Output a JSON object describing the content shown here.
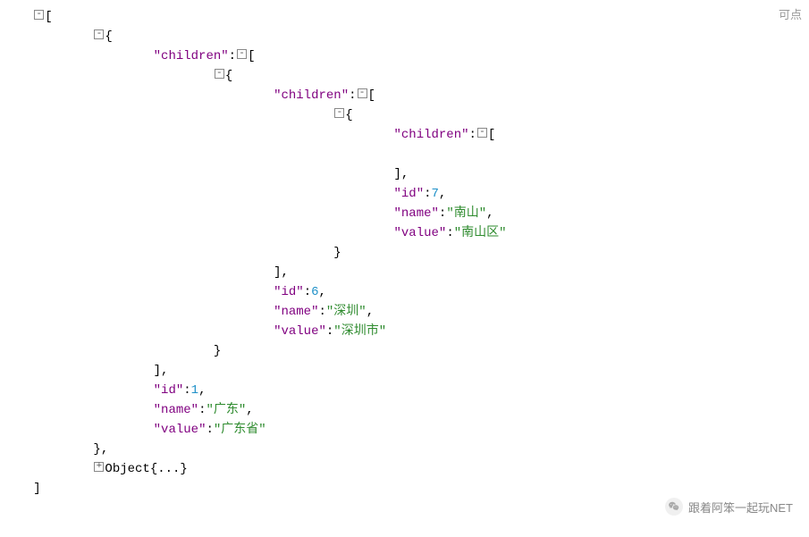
{
  "topRight": "可点",
  "watermark": "跟着阿笨一起玩NET",
  "keys": {
    "children": "children",
    "id": "id",
    "name": "name",
    "value": "value"
  },
  "collapsed": "Object{...}",
  "tree": {
    "level1": {
      "id": 1,
      "name": "广东",
      "value": "广东省"
    },
    "level2": {
      "id": 6,
      "name": "深圳",
      "value": "深圳市"
    },
    "level3": {
      "id": 7,
      "name": "南山",
      "value": "南山区"
    }
  }
}
